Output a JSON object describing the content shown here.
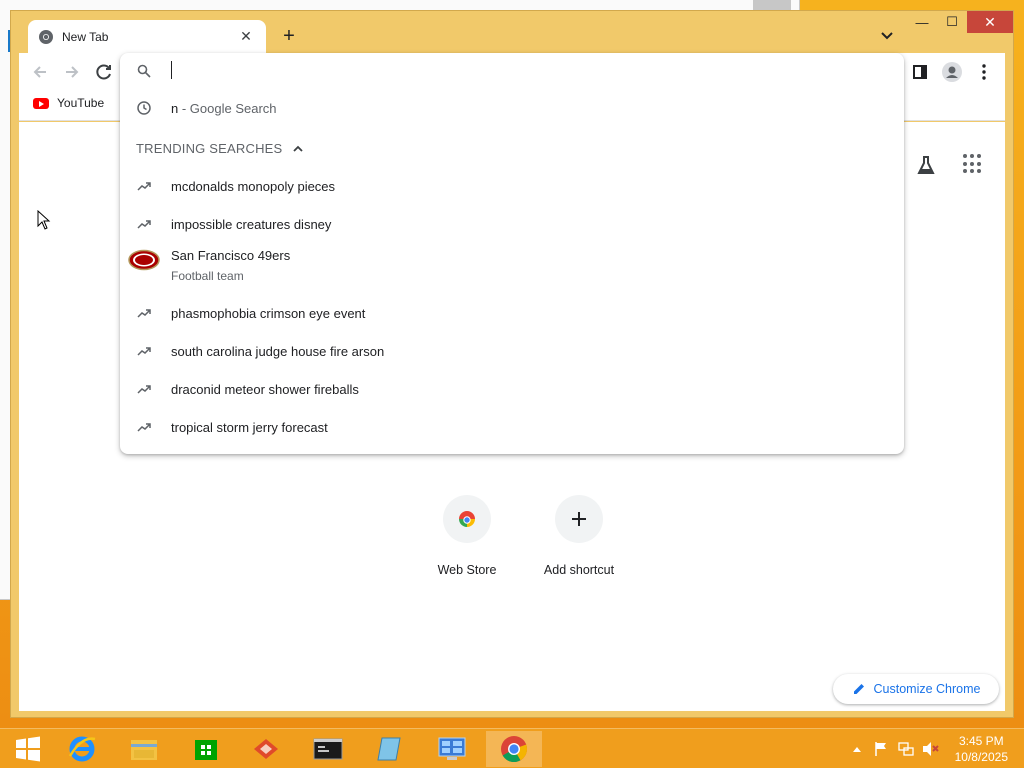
{
  "browser": {
    "tab": {
      "title": "New Tab",
      "close_glyph": "✕"
    },
    "new_tab_glyph": "+",
    "window_controls": {
      "minimize": "—",
      "maximize": "☐",
      "close": "✕"
    },
    "bookmarks": [
      {
        "label": "YouTube",
        "icon": "youtube-icon"
      }
    ]
  },
  "omnibox": {
    "input_value": "",
    "history_suggestion": {
      "query": "n",
      "suffix": " - Google Search",
      "icon": "clock-icon"
    },
    "trending_header": "TRENDING SEARCHES",
    "trending": [
      {
        "text": "mcdonalds monopoly pieces"
      },
      {
        "text": "impossible creatures disney"
      },
      {
        "text": "San Francisco 49ers",
        "subtitle": "Football team",
        "entity": true
      },
      {
        "text": "phasmophobia crimson eye event"
      },
      {
        "text": "south carolina judge house fire arson"
      },
      {
        "text": "draconid meteor shower fireballs"
      },
      {
        "text": "tropical storm jerry forecast"
      }
    ]
  },
  "newtab": {
    "shortcuts": [
      {
        "label": "Web Store",
        "icon": "web-store-icon"
      },
      {
        "label": "Add shortcut",
        "icon": "plus-icon"
      }
    ],
    "customize_label": "Customize Chrome"
  },
  "taskbar": {
    "apps": [
      "start-button",
      "internet-explorer",
      "file-explorer",
      "store",
      "app-red",
      "command-prompt",
      "notepad",
      "control-panel",
      "chrome"
    ],
    "clock": {
      "time": "3:45 PM",
      "date": "10/8/2025"
    }
  },
  "colors": {
    "accent": "#1a73e8",
    "taskbar": "#f0a21c",
    "chrome_frame": "#f1c96a",
    "close_red": "#c7463a"
  }
}
